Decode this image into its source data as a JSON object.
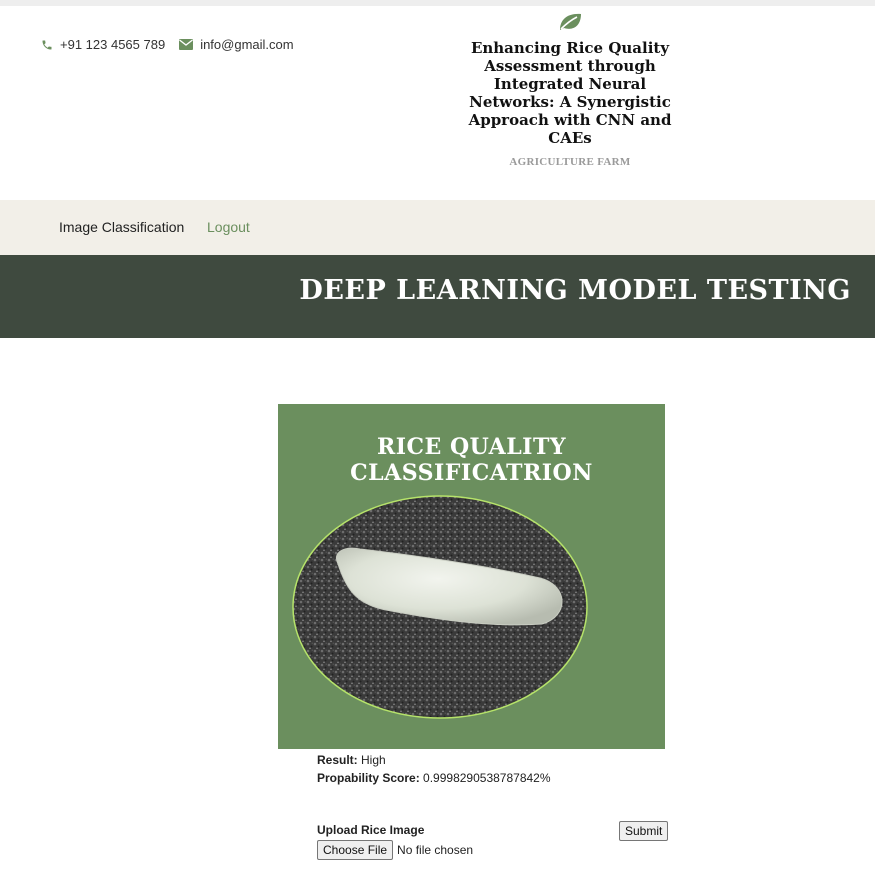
{
  "contact": {
    "phone": "+91 123 4565 789",
    "phone_icon": "phone-icon",
    "email": "info@gmail.com",
    "email_icon": "envelope-icon"
  },
  "brand": {
    "icon": "leaf-icon",
    "title": "Enhancing Rice Quality Assessment through Integrated Neural Networks: A Synergistic Approach with CNN and CAEs",
    "subtitle": "AGRICULTURE FARM"
  },
  "nav": {
    "items": [
      {
        "label": "Image Classification"
      },
      {
        "label": "Logout"
      }
    ]
  },
  "banner": {
    "title": "DEEP LEARNING MODEL TESTING"
  },
  "card": {
    "title": "RICE QUALITY CLASSIFICATRION"
  },
  "result": {
    "result_label": "Result:",
    "result_value": "High",
    "score_label": "Propability Score:",
    "score_value": "0.9998290538787842%"
  },
  "upload": {
    "label": "Upload Rice Image",
    "choose_button": "Choose File",
    "file_status": "No file chosen",
    "submit_button": "Submit"
  },
  "colors": {
    "accent_green": "#6b8f5e",
    "banner_bg": "#3f4a3f",
    "nav_bg": "#f2efe8"
  }
}
